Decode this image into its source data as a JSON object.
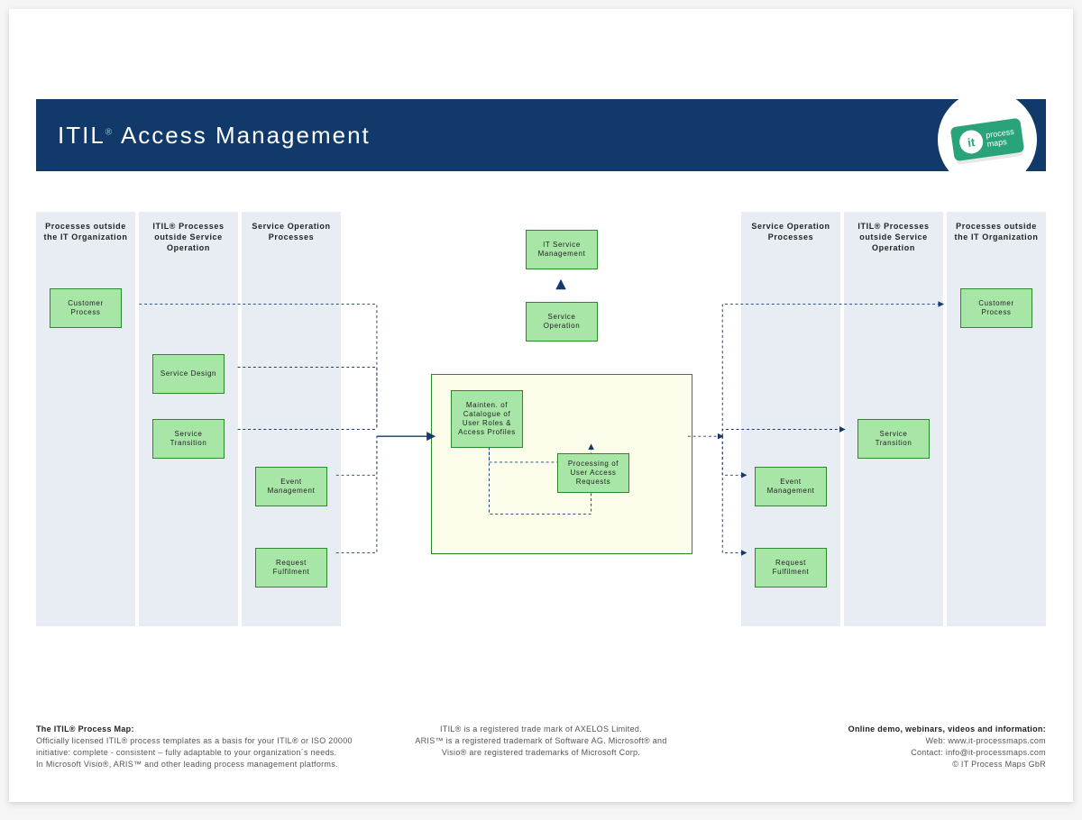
{
  "header": {
    "brand": "ITIL",
    "sup": "®",
    "title": "Access Management"
  },
  "logo": {
    "it": "it",
    "line1": "process",
    "line2": "maps"
  },
  "columns": {
    "left1": "Processes outside the IT Organization",
    "left2": "ITIL® Processes outside Service Operation",
    "left3": "Service Operation Processes",
    "right3": "Service Operation Processes",
    "right2": "ITIL® Processes outside Service Operation",
    "right1": "Processes outside the IT Organization"
  },
  "boxes": {
    "customer_left": "Customer Process",
    "service_design": "Service Design",
    "service_transition_left": "Service Transition",
    "event_mgmt_left": "Event Management",
    "request_fulfil_left": "Request Fulfilment",
    "it_service_mgmt": "IT Service Management",
    "service_operation": "Service Operation",
    "maint_catalogue": "Mainten. of Catalogue of User Roles & Access Profiles",
    "processing_requests": "Processing of User Access Requests",
    "event_mgmt_right": "Event Management",
    "request_fulfil_right": "Request Fulfilment",
    "service_transition_right": "Service Transition",
    "customer_right": "Customer Process"
  },
  "footer": {
    "left_title": "The ITIL® Process Map:",
    "left_line1": "Officially licensed ITIL® process templates as a basis for your ITIL® or ISO 20000",
    "left_line2": "initiative: complete - consistent – fully adaptable to your organization´s needs.",
    "left_line3": "In Microsoft Visio®, ARIS™ and other leading process management platforms.",
    "center_line1": "ITIL® is a registered trade mark of AXELOS Limited.",
    "center_line2": "ARIS™ is a  registered trademark of Software AG. Microsoft® and",
    "center_line3": "Visio® are registered trademarks of Microsoft Corp.",
    "right_title": "Online demo, webinars, videos and information:",
    "right_line1": "Web: www.it-processmaps.com",
    "right_line2": "Contact: info@it-processmaps.com",
    "right_line3": "© IT Process Maps GbR"
  }
}
